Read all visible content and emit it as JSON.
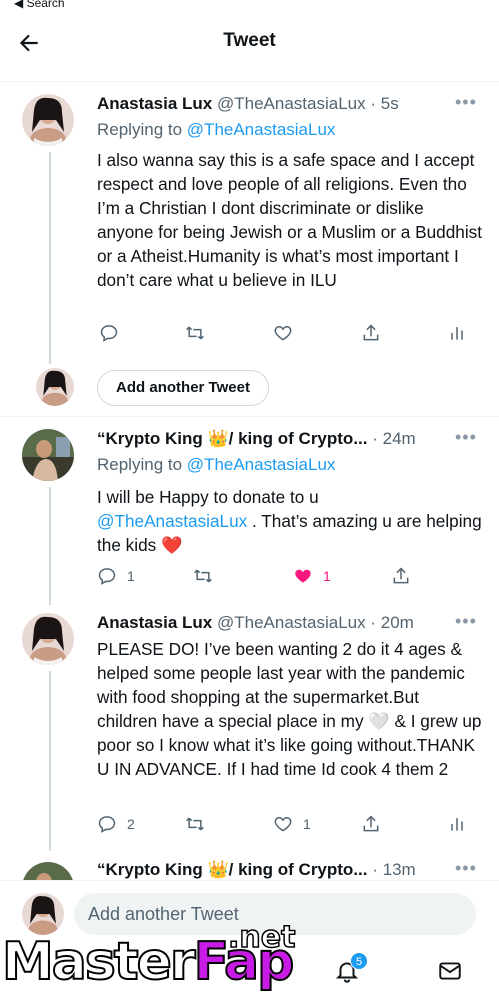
{
  "status_bar": {
    "back_label": "◀ Search"
  },
  "header": {
    "title": "Tweet"
  },
  "tweets": [
    {
      "name": "Anastasia Lux",
      "handle": "@TheAnastasiaLux",
      "dot": "·",
      "time": "5s",
      "replying_prefix": "Replying to",
      "replying_handle": "@TheAnastasiaLux",
      "body": "I also wanna say this is a safe space and I accept respect and love people of all religions. Even tho I’m a Christian I dont discriminate or dislike anyone for being Jewish or a Muslim or a Buddhist or a Atheist.Humanity is what’s most important I don’t care what u believe in ILU",
      "reply_count": "",
      "retweet_count": "",
      "like_count": ""
    },
    {
      "name": "“Krypto King 👑/ king of Crypto...",
      "handle": "",
      "dot": "·",
      "time": "24m",
      "replying_prefix": "Replying to",
      "replying_handle": "@TheAnastasiaLux",
      "body_pre": "I will be Happy to donate to u",
      "body_link": "@TheAnastasiaLux",
      "body_post": " .  That’s amazing u are helping the kids ❤️",
      "reply_count": "1",
      "retweet_count": "",
      "like_count": "1"
    },
    {
      "name": "Anastasia Lux",
      "handle": "@TheAnastasiaLux",
      "dot": "·",
      "time": "20m",
      "body": "PLEASE DO! I’ve been wanting 2 do it 4 ages & helped some people last year with the pandemic with food shopping at the supermarket.But children have a special place in my 🤍 & I grew up poor so I know what it’s like going without.THANK U IN ADVANCE. If I had time Id cook 4 them 2",
      "reply_count": "2",
      "retweet_count": "",
      "like_count": "1"
    },
    {
      "name": "“Krypto King 👑/ king of Crypto...",
      "dot": "·",
      "time": "13m"
    }
  ],
  "add_thread_button": "Add another Tweet",
  "composer": {
    "placeholder": "Add another Tweet"
  },
  "tabbar": {
    "notification_badge": "5"
  },
  "watermark": {
    "master": "Master",
    "fap": "Fap",
    "net": ".net"
  },
  "colors": {
    "accent": "#1d9bf0",
    "like": "#f91880",
    "muted": "#536471"
  }
}
